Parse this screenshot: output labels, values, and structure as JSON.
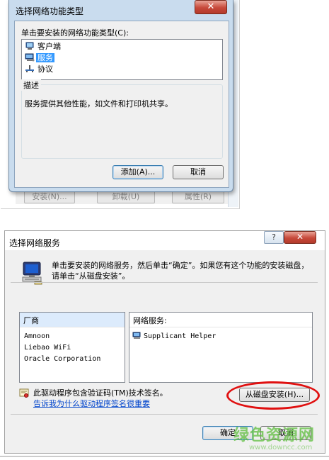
{
  "dialog1": {
    "title": "选择网络功能类型",
    "close_glyph": "✕",
    "prompt": "单击要安装的网络功能类型(C):",
    "items": [
      {
        "label": "客户端",
        "icon": "client-icon",
        "selected": false
      },
      {
        "label": "服务",
        "icon": "service-icon",
        "selected": true
      },
      {
        "label": "协议",
        "icon": "protocol-icon",
        "selected": false
      }
    ],
    "description_title": "描述",
    "description": "服务提供其他性能，如文件和打印机共享。",
    "add_button": "添加(A)...",
    "cancel_button": "取消",
    "background_buttons": [
      "安装(N)...",
      "卸载(U)",
      "属性(R)"
    ]
  },
  "dialog2": {
    "title": "选择网络服务",
    "help_glyph": "?",
    "close_glyph": "✕",
    "message": "单击要安装的网络服务，然后单击“确定”。如果您有这个功能的安装磁盘，请单击“从磁盘安装”。",
    "vendor_header": "厂商",
    "vendors": [
      "Amnoon",
      "Liebao WiFi",
      "Oracle Corporation"
    ],
    "service_header": "网络服务:",
    "services": [
      "Supplicant Helper"
    ],
    "cert_text": "此驱动程序包含验证码(TM)技术签名。",
    "link_text": "告诉我为什么驱动程序签名很重要",
    "disk_button": "从磁盘安装(H)...",
    "ok_button": "确定",
    "cancel_button": "取消"
  },
  "watermark": {
    "text": "绿色资源网",
    "url": "www.downcc.com"
  },
  "colors": {
    "selection": "#3399ff",
    "highlight_oval": "#e01010",
    "link": "#0044cc",
    "watermark": "#5fbf3f"
  }
}
